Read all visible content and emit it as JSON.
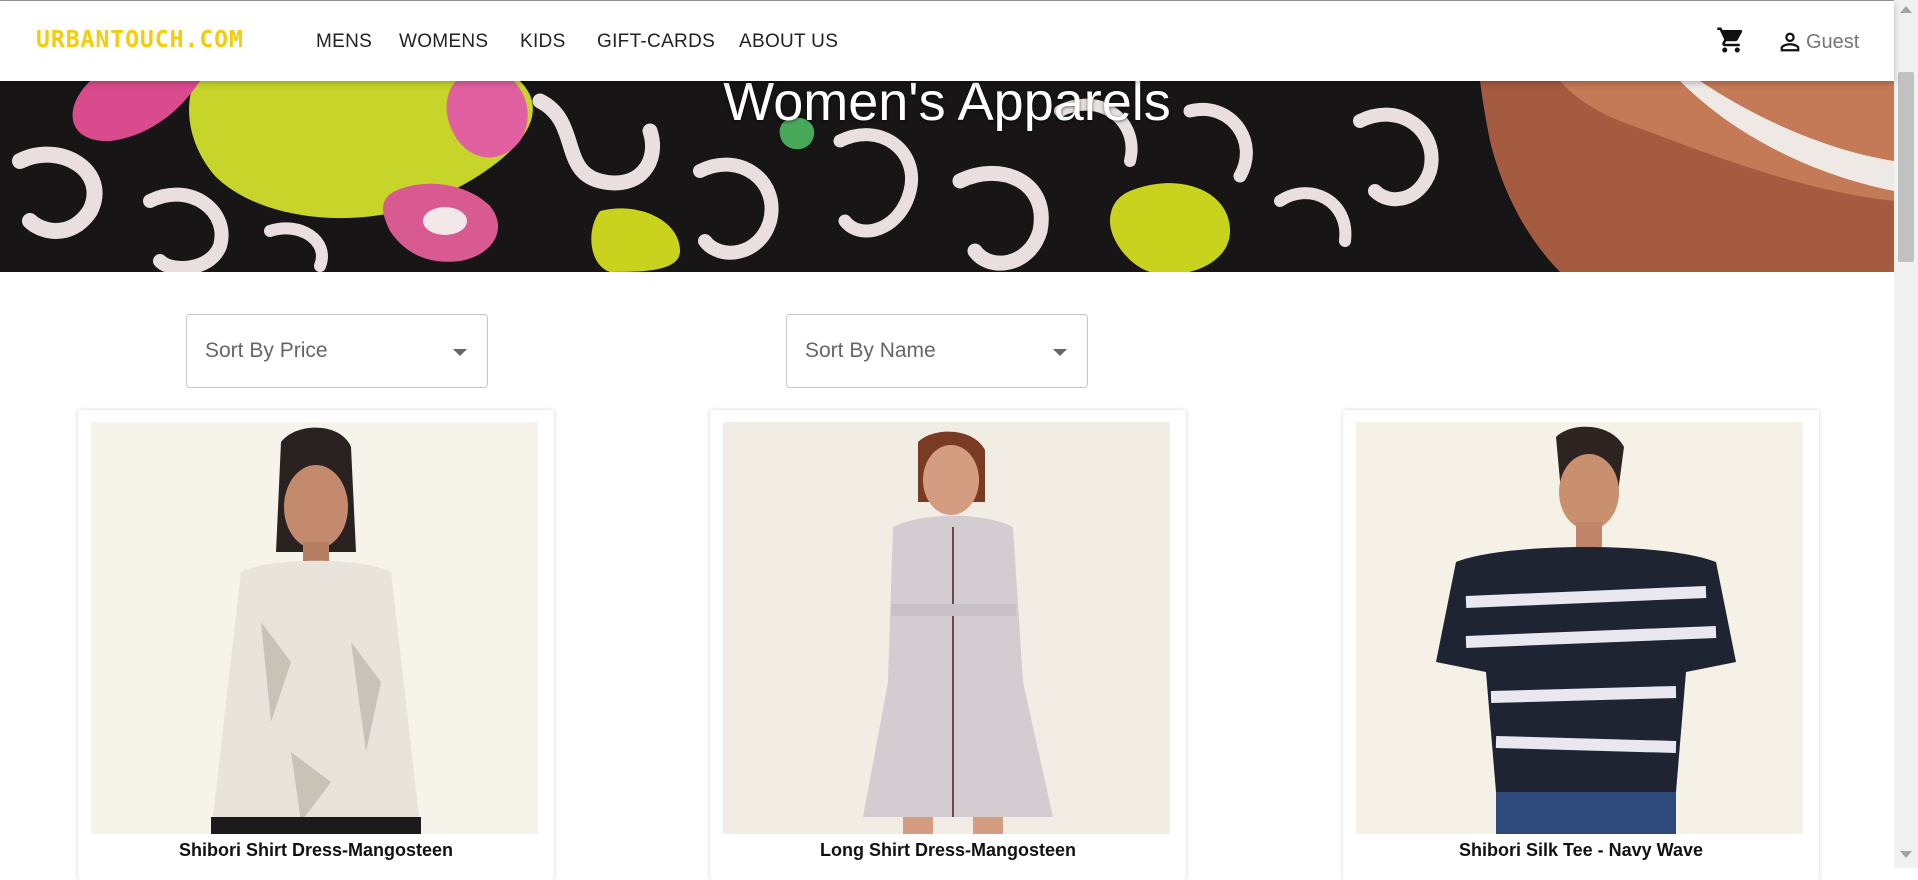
{
  "header": {
    "logo": "URBANTOUCH.COM",
    "nav": [
      "MENS",
      "WOMENS",
      "KIDS",
      "GIFT-CARDS",
      "ABOUT US"
    ],
    "user_label": "Guest",
    "accent_color": "#f3cd0b"
  },
  "hero": {
    "title": "Women's Apparels"
  },
  "filters": {
    "sort_price": "Sort By Price",
    "sort_name": "Sort By Name"
  },
  "products": [
    {
      "name": "Shibori Shirt Dress-Mangosteen"
    },
    {
      "name": "Long Shirt Dress-Mangosteen"
    },
    {
      "name": "Shibori Silk Tee - Navy Wave"
    }
  ],
  "icons": [
    "cart-icon",
    "user-icon",
    "caret-down-icon"
  ]
}
